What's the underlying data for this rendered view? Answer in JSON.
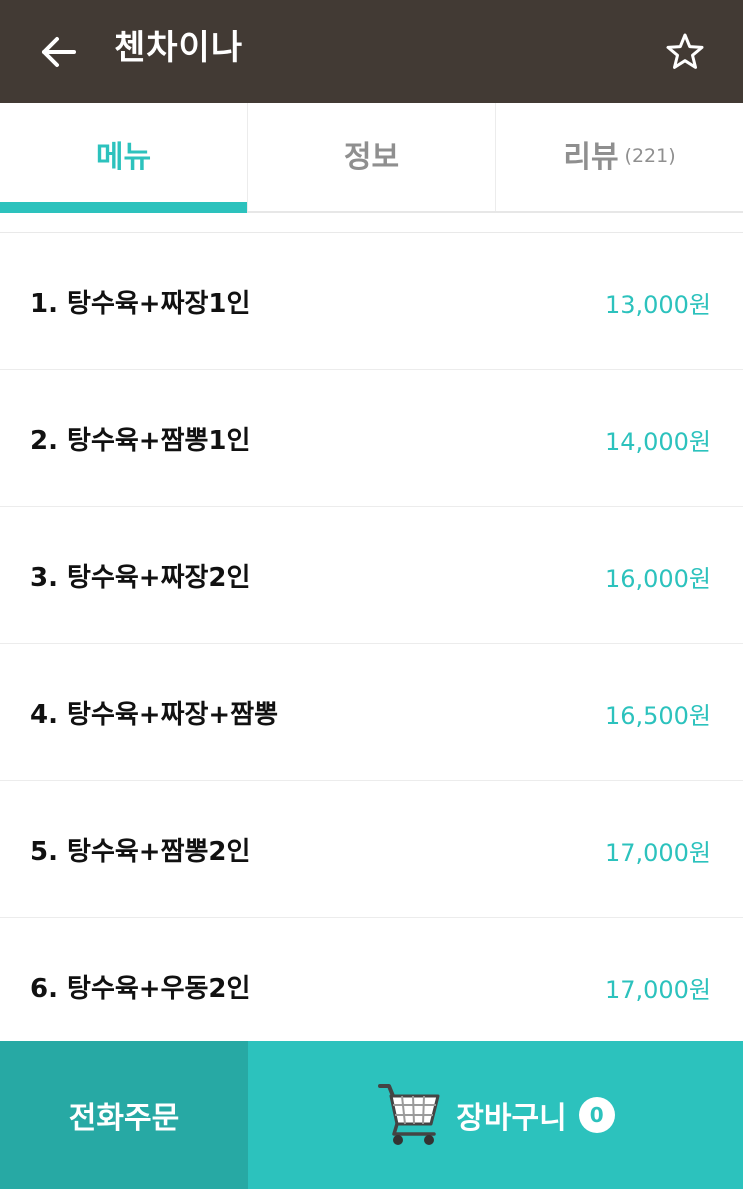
{
  "header": {
    "title": "첸차이나",
    "back_icon": "arrow-left-icon",
    "favorite_icon": "star-outline-icon"
  },
  "tabs": [
    {
      "label": "메뉴",
      "count": "",
      "active": true
    },
    {
      "label": "정보",
      "count": "",
      "active": false
    },
    {
      "label": "리뷰",
      "count": "(221)",
      "active": false
    }
  ],
  "menu": {
    "items": [
      {
        "name": "1. 탕수육+짜장1인",
        "price": "13,000원"
      },
      {
        "name": "2. 탕수육+짬뽕1인",
        "price": "14,000원"
      },
      {
        "name": "3. 탕수육+짜장2인",
        "price": "16,000원"
      },
      {
        "name": "4. 탕수육+짜장+짬뽕",
        "price": "16,500원"
      },
      {
        "name": "5. 탕수육+짬뽕2인",
        "price": "17,000원"
      },
      {
        "name": "6. 탕수육+우동2인",
        "price": "17,000원"
      }
    ]
  },
  "bottom_bar": {
    "call_label": "전화주문",
    "cart_label": "장바구니",
    "cart_count": "0",
    "cart_icon": "shopping-cart-icon"
  },
  "colors": {
    "header_bg": "#423a34",
    "accent": "#2cc2bd",
    "accent_dark": "#27a9a4",
    "text": "#111111",
    "muted": "#8f8f8f"
  }
}
